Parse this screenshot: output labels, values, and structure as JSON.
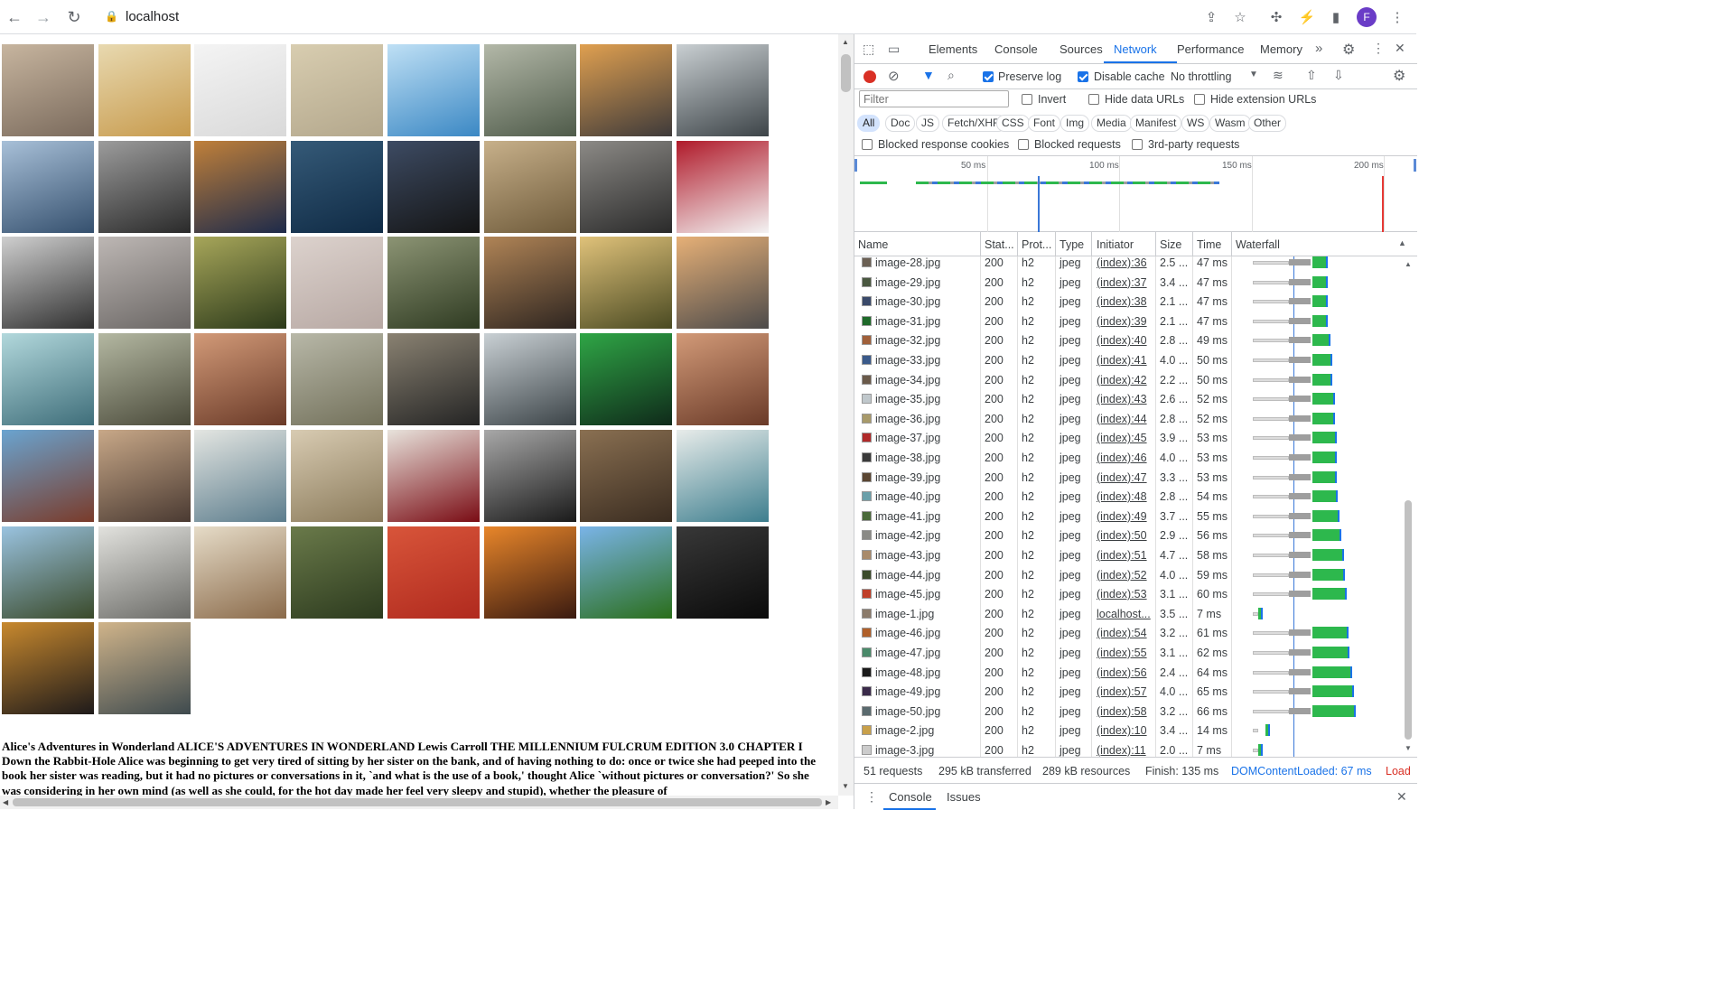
{
  "browser": {
    "url": "localhost",
    "avatar_letter": "F"
  },
  "page": {
    "thumbnails": [
      {
        "colors": [
          "#7a6a5c",
          "#c7b59f"
        ]
      },
      {
        "colors": [
          "#c79a4c",
          "#e8d9b0"
        ]
      },
      {
        "colors": [
          "#d9d9d9",
          "#f4f4f4"
        ]
      },
      {
        "colors": [
          "#b3a78c",
          "#d8cdb0"
        ]
      },
      {
        "colors": [
          "#3b88c4",
          "#bfe0f5"
        ]
      },
      {
        "colors": [
          "#4f5b4a",
          "#b3b8a8"
        ]
      },
      {
        "colors": [
          "#3e3a3a",
          "#e0a050"
        ]
      },
      {
        "colors": [
          "#3d4448",
          "#c9cfd2"
        ]
      },
      {
        "colors": [
          "#35506e",
          "#a8c0d8"
        ]
      },
      {
        "colors": [
          "#2a2a2a",
          "#9c9c9c"
        ]
      },
      {
        "colors": [
          "#1d2a4a",
          "#c0803a"
        ]
      },
      {
        "colors": [
          "#0f2a44",
          "#355a78"
        ]
      },
      {
        "colors": [
          "#141414",
          "#3d4b63"
        ]
      },
      {
        "colors": [
          "#6e5a3a",
          "#c7b08a"
        ]
      },
      {
        "colors": [
          "#2a2a2a",
          "#8c8a86"
        ]
      },
      {
        "colors": [
          "#f3f3f3",
          "#b01a2a"
        ]
      },
      {
        "colors": [
          "#303030",
          "#cfcfcf"
        ]
      },
      {
        "colors": [
          "#6a6664",
          "#bdb7b4"
        ]
      },
      {
        "colors": [
          "#2c3a1a",
          "#a7a65a"
        ]
      },
      {
        "colors": [
          "#b7a8a3",
          "#dcd2cd"
        ]
      },
      {
        "colors": [
          "#2f3b22",
          "#8c9474"
        ]
      },
      {
        "colors": [
          "#2e2520",
          "#b08456"
        ]
      },
      {
        "colors": [
          "#4a4a22",
          "#e0c27a"
        ]
      },
      {
        "colors": [
          "#4c4a4a",
          "#e6b077"
        ]
      },
      {
        "colors": [
          "#3f6e7a",
          "#b2d8dc"
        ]
      },
      {
        "colors": [
          "#4a4a3a",
          "#b4b8a2"
        ]
      },
      {
        "colors": [
          "#6a3a28",
          "#d29a78"
        ]
      },
      {
        "colors": [
          "#72705a",
          "#b8b8a8"
        ]
      },
      {
        "colors": [
          "#242424",
          "#8a8272"
        ]
      },
      {
        "colors": [
          "#3c4448",
          "#c9d0d4"
        ]
      },
      {
        "colors": [
          "#0f2a1a",
          "#2fa646"
        ]
      },
      {
        "colors": [
          "#6a3a28",
          "#d29a78"
        ]
      },
      {
        "colors": [
          "#7a3b2a",
          "#6aa4d0"
        ]
      },
      {
        "colors": [
          "#4a3a32",
          "#c8a888"
        ]
      },
      {
        "colors": [
          "#5b7c8c",
          "#e4e6e2"
        ]
      },
      {
        "colors": [
          "#8a7a5a",
          "#d8cbb2"
        ]
      },
      {
        "colors": [
          "#7a0c14",
          "#e8e3dc"
        ]
      },
      {
        "colors": [
          "#1a1a1a",
          "#a8a8a8"
        ]
      },
      {
        "colors": [
          "#3a2c20",
          "#8a7052"
        ]
      },
      {
        "colors": [
          "#3d7e8e",
          "#e8ecea"
        ]
      },
      {
        "colors": [
          "#3a4a2a",
          "#9ac3e0"
        ]
      },
      {
        "colors": [
          "#6a6a66",
          "#e2e2de"
        ]
      },
      {
        "colors": [
          "#8a6a4a",
          "#e6dcc8"
        ]
      },
      {
        "colors": [
          "#2c3a1e",
          "#6a7a4a"
        ]
      },
      {
        "colors": [
          "#b02a1e",
          "#d8553a"
        ]
      },
      {
        "colors": [
          "#3a1a10",
          "#e8862a"
        ]
      },
      {
        "colors": [
          "#2a6e1a",
          "#7ab4e8"
        ]
      },
      {
        "colors": [
          "#0a0a0a",
          "#383838"
        ]
      },
      {
        "colors": [
          "#1e1a1a",
          "#c8892e"
        ]
      },
      {
        "colors": [
          "#3e4a4e",
          "#d0b48a"
        ]
      }
    ],
    "book_text": "Alice's Adventures in Wonderland ALICE'S ADVENTURES IN WONDERLAND Lewis Carroll THE MILLENNIUM FULCRUM EDITION 3.0 CHAPTER I Down the Rabbit-Hole Alice was beginning to get very tired of sitting by her sister on the bank, and of having nothing to do: once or twice she had peeped into the book her sister was reading, but it had no pictures or conversations in it, `and what is the use of a book,' thought Alice `without pictures or conversation?' So she was considering in her own mind (as well as she could, for the hot day made her feel very sleepy and stupid), whether the pleasure of"
  },
  "devtools": {
    "tabs": [
      "Elements",
      "Console",
      "Sources",
      "Network",
      "Performance",
      "Memory"
    ],
    "active_tab": "Network",
    "toolbar": {
      "preserve_log": "Preserve log",
      "disable_cache": "Disable cache",
      "throttling": "No throttling"
    },
    "filter": {
      "placeholder": "Filter",
      "invert": "Invert",
      "hide_data_urls": "Hide data URLs",
      "hide_extension_urls": "Hide extension URLs"
    },
    "type_filters": [
      "All",
      "Doc",
      "JS",
      "Fetch/XHR",
      "CSS",
      "Font",
      "Img",
      "Media",
      "Manifest",
      "WS",
      "Wasm",
      "Other"
    ],
    "checks": {
      "blocked_cookies": "Blocked response cookies",
      "blocked_requests": "Blocked requests",
      "third_party": "3rd-party requests"
    },
    "overview_ticks": [
      "50 ms",
      "100 ms",
      "150 ms",
      "200 ms"
    ],
    "columns": [
      "Name",
      "Stat...",
      "Prot...",
      "Type",
      "Initiator",
      "Size",
      "Time",
      "Waterfall"
    ],
    "rows": [
      {
        "name": "image-28.jpg",
        "status": "200",
        "proto": "h2",
        "type": "jpeg",
        "initiator": "(index):36",
        "size": "2.5 ...",
        "time": "47 ms",
        "color": "#6b6054"
      },
      {
        "name": "image-29.jpg",
        "status": "200",
        "proto": "h2",
        "type": "jpeg",
        "initiator": "(index):37",
        "size": "3.4 ...",
        "time": "47 ms",
        "color": "#4a5840"
      },
      {
        "name": "image-30.jpg",
        "status": "200",
        "proto": "h2",
        "type": "jpeg",
        "initiator": "(index):38",
        "size": "2.1 ...",
        "time": "47 ms",
        "color": "#3a4a6a"
      },
      {
        "name": "image-31.jpg",
        "status": "200",
        "proto": "h2",
        "type": "jpeg",
        "initiator": "(index):39",
        "size": "2.1 ...",
        "time": "47 ms",
        "color": "#1f6a2a"
      },
      {
        "name": "image-32.jpg",
        "status": "200",
        "proto": "h2",
        "type": "jpeg",
        "initiator": "(index):40",
        "size": "2.8 ...",
        "time": "49 ms",
        "color": "#a0603a"
      },
      {
        "name": "image-33.jpg",
        "status": "200",
        "proto": "h2",
        "type": "jpeg",
        "initiator": "(index):41",
        "size": "4.0 ...",
        "time": "50 ms",
        "color": "#3a5a8a"
      },
      {
        "name": "image-34.jpg",
        "status": "200",
        "proto": "h2",
        "type": "jpeg",
        "initiator": "(index):42",
        "size": "2.2 ...",
        "time": "50 ms",
        "color": "#6a5a4a"
      },
      {
        "name": "image-35.jpg",
        "status": "200",
        "proto": "h2",
        "type": "jpeg",
        "initiator": "(index):43",
        "size": "2.6 ...",
        "time": "52 ms",
        "color": "#c0c8cc"
      },
      {
        "name": "image-36.jpg",
        "status": "200",
        "proto": "h2",
        "type": "jpeg",
        "initiator": "(index):44",
        "size": "2.8 ...",
        "time": "52 ms",
        "color": "#a89a6a"
      },
      {
        "name": "image-37.jpg",
        "status": "200",
        "proto": "h2",
        "type": "jpeg",
        "initiator": "(index):45",
        "size": "3.9 ...",
        "time": "53 ms",
        "color": "#b02a2a"
      },
      {
        "name": "image-38.jpg",
        "status": "200",
        "proto": "h2",
        "type": "jpeg",
        "initiator": "(index):46",
        "size": "4.0 ...",
        "time": "53 ms",
        "color": "#3a3a3a"
      },
      {
        "name": "image-39.jpg",
        "status": "200",
        "proto": "h2",
        "type": "jpeg",
        "initiator": "(index):47",
        "size": "3.3 ...",
        "time": "53 ms",
        "color": "#5a4632"
      },
      {
        "name": "image-40.jpg",
        "status": "200",
        "proto": "h2",
        "type": "jpeg",
        "initiator": "(index):48",
        "size": "2.8 ...",
        "time": "54 ms",
        "color": "#6aa0aa"
      },
      {
        "name": "image-41.jpg",
        "status": "200",
        "proto": "h2",
        "type": "jpeg",
        "initiator": "(index):49",
        "size": "3.7 ...",
        "time": "55 ms",
        "color": "#4a6a3a"
      },
      {
        "name": "image-42.jpg",
        "status": "200",
        "proto": "h2",
        "type": "jpeg",
        "initiator": "(index):50",
        "size": "2.9 ...",
        "time": "56 ms",
        "color": "#8a8a86"
      },
      {
        "name": "image-43.jpg",
        "status": "200",
        "proto": "h2",
        "type": "jpeg",
        "initiator": "(index):51",
        "size": "4.7 ...",
        "time": "58 ms",
        "color": "#a88a6a"
      },
      {
        "name": "image-44.jpg",
        "status": "200",
        "proto": "h2",
        "type": "jpeg",
        "initiator": "(index):52",
        "size": "4.0 ...",
        "time": "59 ms",
        "color": "#3a4a2a"
      },
      {
        "name": "image-45.jpg",
        "status": "200",
        "proto": "h2",
        "type": "jpeg",
        "initiator": "(index):53",
        "size": "3.1 ...",
        "time": "60 ms",
        "color": "#c0402a"
      },
      {
        "name": "image-1.jpg",
        "status": "200",
        "proto": "h2",
        "type": "jpeg",
        "initiator": "localhost...",
        "size": "3.5 ...",
        "time": "7 ms",
        "color": "#8a7a6a"
      },
      {
        "name": "image-46.jpg",
        "status": "200",
        "proto": "h2",
        "type": "jpeg",
        "initiator": "(index):54",
        "size": "3.2 ...",
        "time": "61 ms",
        "color": "#b0602a"
      },
      {
        "name": "image-47.jpg",
        "status": "200",
        "proto": "h2",
        "type": "jpeg",
        "initiator": "(index):55",
        "size": "3.1 ...",
        "time": "62 ms",
        "color": "#4a8a6a"
      },
      {
        "name": "image-48.jpg",
        "status": "200",
        "proto": "h2",
        "type": "jpeg",
        "initiator": "(index):56",
        "size": "2.4 ...",
        "time": "64 ms",
        "color": "#1a1a1a"
      },
      {
        "name": "image-49.jpg",
        "status": "200",
        "proto": "h2",
        "type": "jpeg",
        "initiator": "(index):57",
        "size": "4.0 ...",
        "time": "65 ms",
        "color": "#3a2a4a"
      },
      {
        "name": "image-50.jpg",
        "status": "200",
        "proto": "h2",
        "type": "jpeg",
        "initiator": "(index):58",
        "size": "3.2 ...",
        "time": "66 ms",
        "color": "#5a6a6e"
      },
      {
        "name": "image-2.jpg",
        "status": "200",
        "proto": "h2",
        "type": "jpeg",
        "initiator": "(index):10",
        "size": "3.4 ...",
        "time": "14 ms",
        "color": "#c8a04a"
      },
      {
        "name": "image-3.jpg",
        "status": "200",
        "proto": "h2",
        "type": "jpeg",
        "initiator": "(index):11",
        "size": "2.0 ...",
        "time": "7 ms",
        "color": "#cccccc"
      }
    ],
    "status_bar": {
      "requests": "51 requests",
      "transferred": "295 kB transferred",
      "resources": "289 kB resources",
      "finish": "Finish: 135 ms",
      "dcl": "DOMContentLoaded: 67 ms",
      "load": "Load"
    },
    "drawer_tabs": [
      "Console",
      "Issues"
    ]
  }
}
